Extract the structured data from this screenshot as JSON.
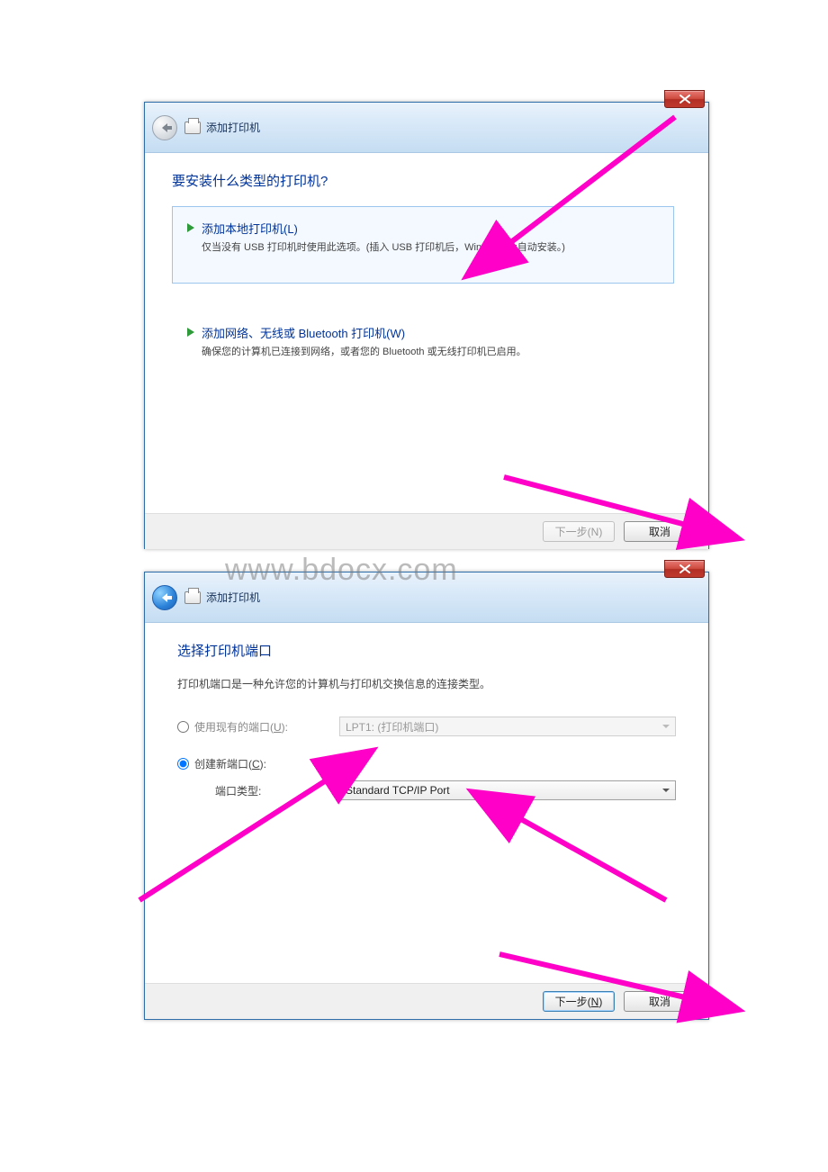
{
  "watermark": "www.bdocx.com",
  "window1": {
    "title": "添加打印机",
    "heading": "要安装什么类型的打印机?",
    "optionLocal": {
      "title": "添加本地打印机(L)",
      "desc": "仅当没有 USB 打印机时使用此选项。(插入 USB 打印机后，Windows 会自动安装。)"
    },
    "optionNetwork": {
      "title": "添加网络、无线或 Bluetooth 打印机(W)",
      "desc": "确保您的计算机已连接到网络，或者您的 Bluetooth 或无线打印机已启用。"
    },
    "next": "下一步(N)",
    "cancel": "取消"
  },
  "window2": {
    "title": "添加打印机",
    "heading": "选择打印机端口",
    "help": "打印机端口是一种允许您的计算机与打印机交换信息的连接类型。",
    "useExistingLabelPrefix": "使用现有的端口(",
    "useExistingLabelKey": "U",
    "useExistingLabelSuffix": "):",
    "existingValue": "LPT1: (打印机端口)",
    "createNewLabelPrefix": "创建新端口(",
    "createNewLabelKey": "C",
    "createNewLabelSuffix": "):",
    "portTypeLabel": "端口类型:",
    "portTypeValue": "Standard TCP/IP Port",
    "nextPrefix": "下一步(",
    "nextKey": "N",
    "nextSuffix": ")",
    "cancel": "取消"
  }
}
